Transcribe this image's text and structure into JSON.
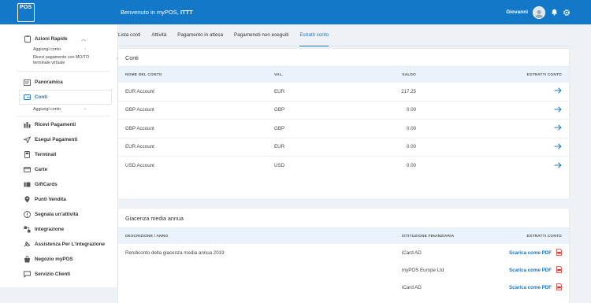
{
  "header": {
    "logo_text": "POS",
    "welcome": "Benvenuto in myPOS,",
    "account_name": "ITTT",
    "user_name": "Giovanni"
  },
  "sidebar": {
    "items": [
      {
        "label": "Azioni Rapide",
        "icon": "clipboard-icon"
      },
      {
        "label": "Aggiungi conto"
      },
      {
        "label": "Ricevi pagamento con MO/TO terminale virtuale"
      },
      {
        "label": "Panoramica",
        "icon": "overview-icon"
      },
      {
        "label": "Conti",
        "icon": "wallet-icon"
      },
      {
        "label": "Aggiungi conto"
      },
      {
        "label": "Ricevi Pagamenti",
        "icon": "receive-icon"
      },
      {
        "label": "Esegui Pagamenti",
        "icon": "send-icon"
      },
      {
        "label": "Terminali",
        "icon": "terminal-icon"
      },
      {
        "label": "Carte",
        "icon": "card-icon"
      },
      {
        "label": "GiftCards",
        "icon": "gift-icon"
      },
      {
        "label": "Punti Vendita",
        "icon": "location-icon"
      },
      {
        "label": "Segnala un'attività",
        "icon": "report-icon"
      },
      {
        "label": "Integrazione",
        "icon": "integration-icon"
      },
      {
        "label": "Assistenza Per L'integrazione",
        "icon": "support-icon"
      },
      {
        "label": "Negozio myPOS",
        "icon": "shop-icon"
      },
      {
        "label": "Servizio Clienti",
        "icon": "chat-icon"
      }
    ]
  },
  "tabs": [
    "Lista conti",
    "Attività",
    "Pagamento in attesa",
    "Pagameneti non eseguiti",
    "Estratti conto"
  ],
  "conti": {
    "title": "Conti",
    "headers": [
      "NOME DEL CONTO",
      "VAL.",
      "SALDO",
      "ESTRATTI CONTO"
    ],
    "rows": [
      {
        "name": "EUR Account",
        "cur": "EUR",
        "balance": "217.25"
      },
      {
        "name": "GBP Account",
        "cur": "GBP",
        "balance": "0.00"
      },
      {
        "name": "GBP Account",
        "cur": "GBP",
        "balance": "0.00"
      },
      {
        "name": "EUR Account",
        "cur": "EUR",
        "balance": "0.00"
      },
      {
        "name": "USD Account",
        "cur": "USD",
        "balance": "0.00"
      }
    ]
  },
  "giacenza": {
    "title": "Giacenza media annua",
    "headers": [
      "DESCRIZIONE / ANNO",
      "ISTITUZIONE FINANZIARIA",
      "ESTRATTI CONTO"
    ],
    "rows": [
      {
        "desc": "Rendiconto della giacenza media annua 2019",
        "inst": "iCard AD",
        "link": "Scarica come PDF"
      },
      {
        "desc": "",
        "inst": "myPOS Europe Ltd",
        "link": "Scarica come PDF"
      },
      {
        "desc": "",
        "inst": "iCard AD",
        "link": "Scarica come PDF"
      }
    ]
  },
  "colors": {
    "brand": "#1478c8",
    "pdf": "#d9342b"
  }
}
